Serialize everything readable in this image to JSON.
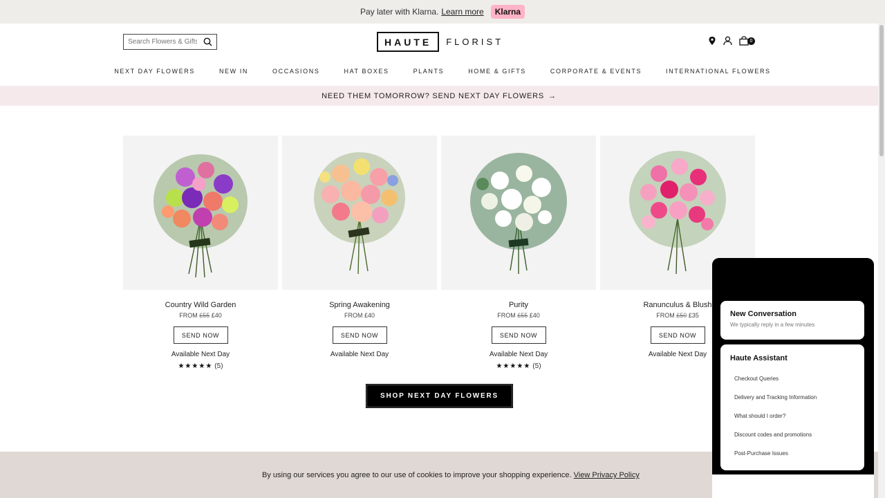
{
  "promo": {
    "text": "Pay later with Klarna.",
    "link": "Learn more",
    "badge": "Klarna"
  },
  "search": {
    "placeholder": "Search Flowers & Gifts"
  },
  "logo": {
    "boxed": "HAUTE",
    "text": "FLORIST"
  },
  "cart": {
    "count": "0"
  },
  "nav": [
    "NEXT DAY FLOWERS",
    "NEW IN",
    "OCCASIONS",
    "HAT BOXES",
    "PLANTS",
    "HOME & GIFTS",
    "CORPORATE & EVENTS",
    "INTERNATIONAL FLOWERS"
  ],
  "banner": {
    "text": "NEED THEM TOMORROW? SEND NEXT DAY FLOWERS",
    "arrow": "→"
  },
  "products": [
    {
      "name": "Country Wild Garden",
      "from": "FROM",
      "old_price": "£55",
      "price": "£40",
      "button": "SEND NOW",
      "availability": "Available Next Day",
      "stars": "★★★★★",
      "reviews": "(5)"
    },
    {
      "name": "Spring Awakening",
      "from": "FROM",
      "old_price": "",
      "price": "£40",
      "button": "SEND NOW",
      "availability": "Available Next Day",
      "stars": "",
      "reviews": ""
    },
    {
      "name": "Purity",
      "from": "FROM",
      "old_price": "£55",
      "price": "£40",
      "button": "SEND NOW",
      "availability": "Available Next Day",
      "stars": "★★★★★",
      "reviews": "(5)"
    },
    {
      "name": "Ranunculus & Blush",
      "from": "FROM",
      "old_price": "£50",
      "price": "£35",
      "button": "SEND NOW",
      "availability": "Available Next Day",
      "stars": "",
      "reviews": ""
    }
  ],
  "shop_button": "SHOP NEXT DAY FLOWERS",
  "cookie": {
    "text": "By using our services you agree to our use of cookies to improve your shopping experience.",
    "link": "View Privacy Policy"
  },
  "chat": {
    "new_conversation": {
      "title": "New Conversation",
      "subtitle": "We typically reply in a few minutes"
    },
    "assistant": {
      "title": "Haute Assistant",
      "items": [
        "Checkout Queries",
        "Delivery and Tracking Information",
        "What should I order?",
        "Discount codes and promotions",
        "Post-Purchase Issues"
      ]
    }
  },
  "colors": {
    "promo_bg": "#efede9",
    "klarna_pink": "#ffb3c7",
    "banner_bg": "#f6e9ec",
    "cookie_bg": "#e0d8d4"
  }
}
